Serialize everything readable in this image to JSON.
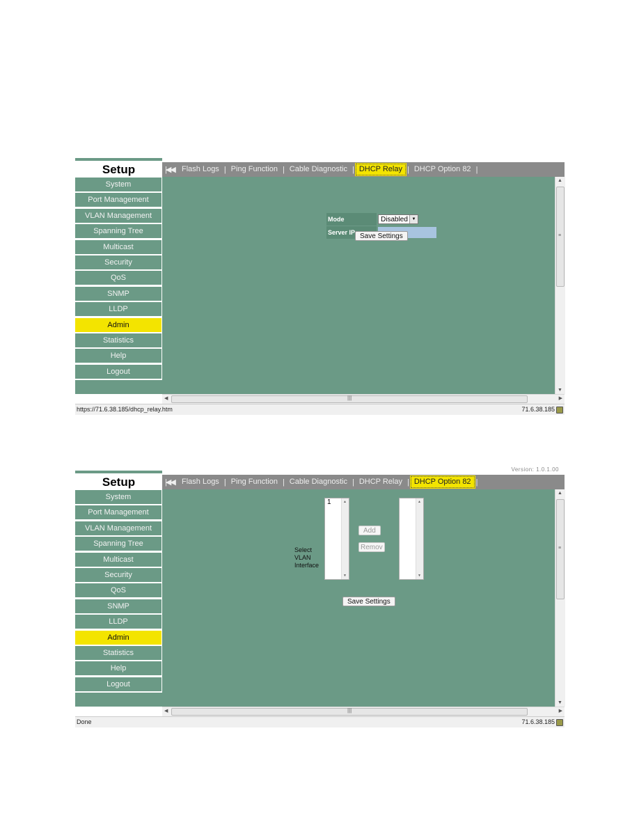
{
  "screens": [
    {
      "sidebar": {
        "title": "Setup",
        "items": [
          {
            "label": "System",
            "active": false
          },
          {
            "label": "Port Management",
            "active": false
          },
          {
            "label": "VLAN Management",
            "active": false
          },
          {
            "label": "Spanning Tree",
            "active": false
          },
          {
            "label": "Multicast",
            "active": false
          },
          {
            "label": "Security",
            "active": false
          },
          {
            "label": "QoS",
            "active": false
          },
          {
            "label": "SNMP",
            "active": false
          },
          {
            "label": "LLDP",
            "active": false
          },
          {
            "label": "Admin",
            "active": true
          },
          {
            "label": "Statistics",
            "active": false
          },
          {
            "label": "Help",
            "active": false
          },
          {
            "label": "Logout",
            "active": false
          }
        ]
      },
      "tabs": {
        "first_icon": "first-page-icon",
        "items": [
          {
            "label": "Flash Logs",
            "active": false
          },
          {
            "label": "Ping Function",
            "active": false
          },
          {
            "label": "Cable Diagnostic",
            "active": false
          },
          {
            "label": "DHCP Relay",
            "active": true
          },
          {
            "label": "DHCP Option 82",
            "active": false
          }
        ]
      },
      "form": {
        "mode_label": "Mode",
        "mode_value": "Disabled",
        "server_ip_label": "Server IP",
        "server_ip_value": "",
        "save_label": "Save Settings"
      },
      "status": {
        "left": "https://71.6.38.185/dhcp_relay.htm",
        "right": "71.6.38.185"
      }
    },
    {
      "version_text": "Version: 1.0.1.00",
      "sidebar": {
        "title": "Setup",
        "items": [
          {
            "label": "System",
            "active": false
          },
          {
            "label": "Port Management",
            "active": false
          },
          {
            "label": "VLAN Management",
            "active": false
          },
          {
            "label": "Spanning Tree",
            "active": false
          },
          {
            "label": "Multicast",
            "active": false
          },
          {
            "label": "Security",
            "active": false
          },
          {
            "label": "QoS",
            "active": false
          },
          {
            "label": "SNMP",
            "active": false
          },
          {
            "label": "LLDP",
            "active": false
          },
          {
            "label": "Admin",
            "active": true
          },
          {
            "label": "Statistics",
            "active": false
          },
          {
            "label": "Help",
            "active": false
          },
          {
            "label": "Logout",
            "active": false
          }
        ]
      },
      "tabs": {
        "first_icon": "first-page-icon",
        "items": [
          {
            "label": "Flash Logs",
            "active": false
          },
          {
            "label": "Ping Function",
            "active": false
          },
          {
            "label": "Cable Diagnostic",
            "active": false
          },
          {
            "label": "DHCP Relay",
            "active": false
          },
          {
            "label": "DHCP Option 82",
            "active": true
          }
        ]
      },
      "form": {
        "select_label_lines": [
          "Select",
          "VLAN",
          "Interface"
        ],
        "available_vlans": [
          "1"
        ],
        "selected_vlans": [],
        "add_label": "Add",
        "remove_label": "Remov",
        "save_label": "Save Settings"
      },
      "status": {
        "left": "Done",
        "right": "71.6.38.185"
      }
    }
  ],
  "colors": {
    "content_bg": "#6b9a86",
    "highlight": "#f3e400",
    "tabbar_bg": "#8a8a8a"
  }
}
